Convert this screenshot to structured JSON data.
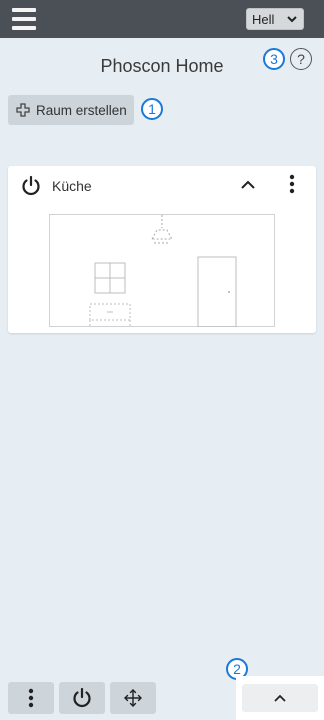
{
  "header": {
    "menu_icon": "hamburger-menu-icon",
    "theme_select": {
      "value": "Hell",
      "options": [
        "Hell"
      ]
    }
  },
  "page": {
    "title": "Phoscon Home"
  },
  "help": {
    "label": "?"
  },
  "markers": [
    "1",
    "2",
    "3"
  ],
  "add_room": {
    "label": "Raum erstellen",
    "icon": "plus-icon"
  },
  "rooms": [
    {
      "name": "Küche",
      "icons": [
        "power-icon",
        "chevron-up-icon",
        "more-vertical-icon"
      ]
    }
  ],
  "bottom_bar": {
    "buttons": [
      "more-vertical-icon",
      "power-icon",
      "move-arrows-icon"
    ],
    "expand_icon": "chevron-up-icon"
  },
  "colors": {
    "topbar": "#4a5055",
    "background": "#e6edf3",
    "marker": "#1a78d8",
    "button": "#cdd4da"
  }
}
